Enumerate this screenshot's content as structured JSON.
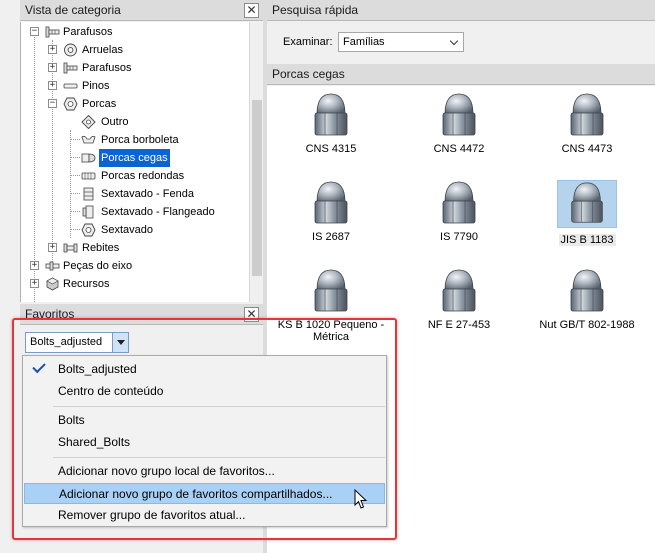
{
  "category_panel": {
    "title": "Vista de categoria",
    "close_glyph": "✕",
    "tree": [
      {
        "label": "Parafusos",
        "icon": "bolt-group-icon",
        "expander": "−"
      },
      {
        "label": "Arruelas",
        "icon": "washer-icon",
        "expander": "+"
      },
      {
        "label": "Parafusos",
        "icon": "bolt-group-icon",
        "expander": "+"
      },
      {
        "label": "Pinos",
        "icon": "pin-icon",
        "expander": "+"
      },
      {
        "label": "Porcas",
        "icon": "nut-icon",
        "expander": "−"
      },
      {
        "label": "Outro",
        "icon": "diamond-nut-icon"
      },
      {
        "label": "Porca borboleta",
        "icon": "wing-nut-icon"
      },
      {
        "label": "Porcas cegas",
        "icon": "cap-nut-icon",
        "selected": true
      },
      {
        "label": "Porcas redondas",
        "icon": "round-nut-icon"
      },
      {
        "label": "Sextavado - Fenda",
        "icon": "slotted-hex-nut-icon"
      },
      {
        "label": "Sextavado - Flangeado",
        "icon": "flanged-hex-nut-icon"
      },
      {
        "label": "Sextavado",
        "icon": "hex-nut-icon"
      },
      {
        "label": "Rebites",
        "icon": "rivet-icon",
        "expander": "+"
      },
      {
        "label": "Peças do eixo",
        "icon": "shaft-part-icon",
        "expander": "+"
      },
      {
        "label": "Recursos",
        "icon": "feature-icon",
        "expander": "+"
      }
    ]
  },
  "favorites_panel": {
    "title": "Favoritos",
    "close_glyph": "✕",
    "selected_group": "Bolts_adjusted"
  },
  "quick_search": {
    "title": "Pesquisa rápida",
    "browse_label": "Examinar:",
    "browse_value": "Famílias"
  },
  "results": {
    "title": "Porcas cegas",
    "items": [
      {
        "label": "CNS 4315"
      },
      {
        "label": "CNS 4472"
      },
      {
        "label": "CNS 4473"
      },
      {
        "label": "IS 2687"
      },
      {
        "label": "IS 7790"
      },
      {
        "label": "JIS B 1183",
        "selected": true
      },
      {
        "label": "KS B 1020 Pequeno - Métrica"
      },
      {
        "label": "NF E 27-453"
      },
      {
        "label": "Nut GB/T 802-1988"
      }
    ]
  },
  "favorites_menu": {
    "items": [
      {
        "label": "Bolts_adjusted",
        "checked": true
      },
      {
        "label": "Centro de conteúdo"
      },
      {
        "label": "Bolts"
      },
      {
        "label": "Shared_Bolts"
      },
      {
        "label": "Adicionar novo grupo local de favoritos..."
      },
      {
        "label": "Adicionar novo grupo de favoritos compartilhados...",
        "highlighted": true
      },
      {
        "label": "Remover grupo de favoritos atual..."
      }
    ]
  },
  "colors": {
    "selection_blue": "#0a64d6",
    "menu_highlight": "#a9d1f5",
    "callout_red": "#e0373c"
  }
}
